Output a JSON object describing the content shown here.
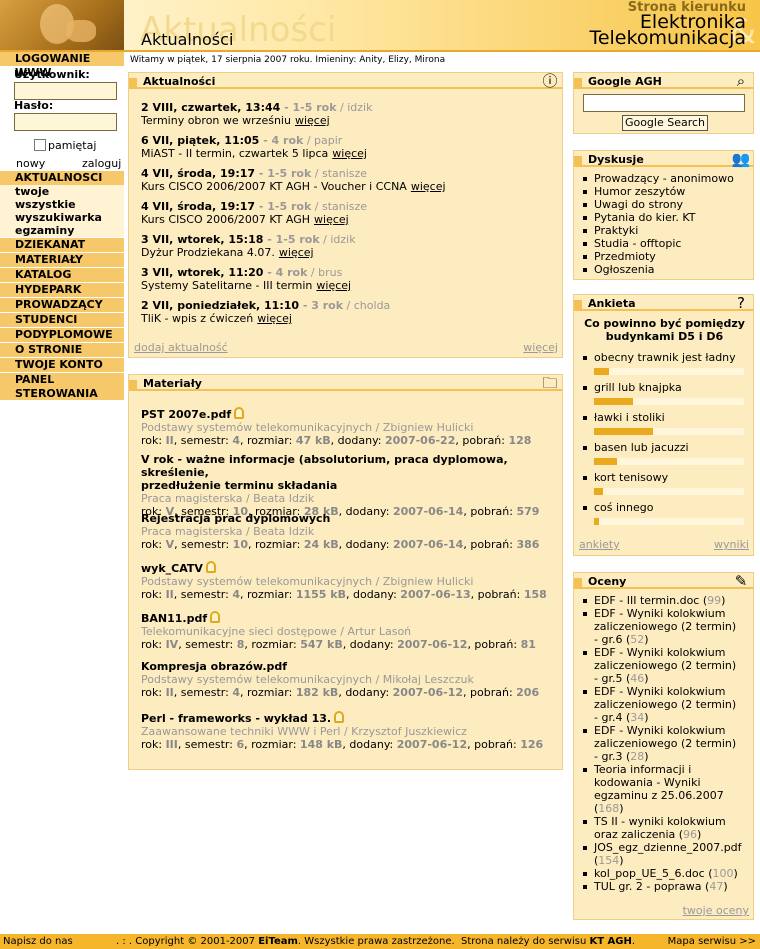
{
  "header": {
    "big_title": "Aktualności",
    "page_title": "Aktualności",
    "strona": "Strona kierunku",
    "kierunek_1": "Elektronika",
    "kierunek_2": "Telekomunikacja",
    "amp": "&"
  },
  "welcome": "Witamy w piątek, 17 sierpnia 2007 roku. Imieniny: Anity, Elizy, Mirona",
  "login": {
    "title": "LOGOWANIE WWW",
    "user_label": "Użytkownik:",
    "pass_label": "Hasło:",
    "remember": "pamiętaj",
    "new": "nowy",
    "login": "zaloguj"
  },
  "nav": {
    "aktualnosci": "AKTUALNOSCI",
    "sub": [
      "twoje",
      "wszystkie",
      "wyszukiwarka",
      "egzaminy"
    ],
    "items": [
      "DZIEKANAT",
      "MATERIAŁY",
      "KATALOG",
      "HYDEPARK",
      "PROWADZĄCY",
      "STUDENCI",
      "PODYPLOMOWE",
      "O STRONIE",
      "TWOJE KONTO"
    ],
    "panel_1": "PANEL",
    "panel_2": "STEROWANIA"
  },
  "news": {
    "title": "Aktualności",
    "items": [
      {
        "date": "2 VIII, czwartek, 13:44",
        "year": " - 1-5 rok",
        "author": " / idzik",
        "text": "Terminy obron we wrześniu",
        "more": "więcej"
      },
      {
        "date": "6 VII, piątek, 11:05",
        "year": " - 4 rok",
        "author": " / papir",
        "text": "MiAST - II termin, czwartek 5 lipca",
        "more": "więcej"
      },
      {
        "date": "4 VII, środa, 19:17",
        "year": " - 1-5 rok",
        "author": " / stanisze",
        "text": "Kurs CISCO 2006/2007 KT AGH - Voucher i CCNA",
        "more": "więcej"
      },
      {
        "date": "4 VII, środa, 19:17",
        "year": " - 1-5 rok",
        "author": " / stanisze",
        "text": "Kurs CISCO 2006/2007 KT AGH",
        "more": "więcej"
      },
      {
        "date": "3 VII, wtorek, 15:18",
        "year": " - 1-5 rok",
        "author": " / idzik",
        "text": "Dyżur Prodziekana 4.07.",
        "more": "więcej"
      },
      {
        "date": "3 VII, wtorek, 11:20",
        "year": " - 4 rok",
        "author": " / brus",
        "text": "Systemy Satelitarne - III termin",
        "more": "więcej"
      },
      {
        "date": "2 VII, poniedziałek, 11:10",
        "year": " - 3 rok",
        "author": " / cholda",
        "text": "TliK - wpis z ćwiczeń",
        "more": "więcej"
      }
    ],
    "add": "dodaj aktualność",
    "more": "więcej"
  },
  "materials": {
    "title": "Materiały",
    "items": [
      {
        "name": "PST 2007e.pdf",
        "lock": true,
        "course": "Podstawy systemów telekomunikacyjnych / Zbigniew Hulicki",
        "rok": "II",
        "sem": "4",
        "size": "47 kB",
        "date": "2007-06-22",
        "dl": "128"
      },
      {
        "name": "V rok - ważne informacje (absolutorium, praca dyplomowa, skreślenie,",
        "name2": "przedłużenie terminu składania",
        "lock": false,
        "course": "Praca magisterska / Beata Idzik",
        "rok": "V",
        "sem": "10",
        "size": "28 kB",
        "date": "2007-06-14",
        "dl": "579"
      },
      {
        "name": "Rejestracja prac dyplomowych",
        "lock": false,
        "course": "Praca magisterska / Beata Idzik",
        "rok": "V",
        "sem": "10",
        "size": "24 kB",
        "date": "2007-06-14",
        "dl": "386"
      },
      {
        "name": "wyk_CATV",
        "lock": true,
        "course": "Podstawy systemów telekomunikacyjnych / Zbigniew Hulicki",
        "rok": "II",
        "sem": "4",
        "size": "1155 kB",
        "date": "2007-06-13",
        "dl": "158"
      },
      {
        "name": "BAN11.pdf",
        "lock": true,
        "course": "Telekomunikacyjne sieci dostępowe / Artur Lasoń",
        "rok": "IV",
        "sem": "8",
        "size": "547 kB",
        "date": "2007-06-12",
        "dl": "81"
      },
      {
        "name": "Kompresja obrazów.pdf",
        "lock": false,
        "course": "Podstawy systemów telekomunikacyjnych / Mikołaj Leszczuk",
        "rok": "II",
        "sem": "4",
        "size": "182 kB",
        "date": "2007-06-12",
        "dl": "206"
      },
      {
        "name": "Perl - frameworks - wykład 13.",
        "lock": true,
        "course": "Zaawansowane techniki WWW i Perl / Krzysztof Juszkiewicz",
        "rok": "III",
        "sem": "6",
        "size": "148 kB",
        "date": "2007-06-12",
        "dl": "126"
      }
    ],
    "labels": {
      "rok": "rok: ",
      "sem": ", semestr: ",
      "size": ", rozmiar: ",
      "date": ", dodany: ",
      "dl": ", pobrań: "
    }
  },
  "google": {
    "title": "Google AGH",
    "button": "Google Search"
  },
  "forums": {
    "title": "Dyskusje",
    "items": [
      "Prowadzący - anonimowo",
      "Humor zeszytów",
      "Uwagi do strony",
      "Pytania do kier. KT",
      "Praktyki",
      "Studia - offtopic",
      "Przedmioty",
      "Ogłoszenia"
    ]
  },
  "poll": {
    "title": "Ankieta",
    "question": "Co powinno być pomiędzy budynkami D5 i D6",
    "options": [
      {
        "label": "obecny trawnik jest ładny",
        "frac": 0.1
      },
      {
        "label": "grill lub knajpka",
        "frac": 0.26
      },
      {
        "label": "ławki i stoliki",
        "frac": 0.39
      },
      {
        "label": "basen lub jacuzzi",
        "frac": 0.15
      },
      {
        "label": "kort tenisowy",
        "frac": 0.06
      },
      {
        "label": "coś innego",
        "frac": 0.03
      }
    ],
    "surveys": "ankiety",
    "results": "wyniki"
  },
  "grades": {
    "title": "Oceny",
    "items": [
      {
        "l": [
          "EDF - III termin.doc"
        ],
        "n": "99"
      },
      {
        "l": [
          "EDF - Wyniki kolokwium",
          "zaliczeniowego (2 termin)",
          "- gr.6"
        ],
        "n": "52"
      },
      {
        "l": [
          "EDF - Wyniki kolokwium",
          "zaliczeniowego (2 termin)",
          "- gr.5"
        ],
        "n": "46"
      },
      {
        "l": [
          "EDF - Wyniki kolokwium",
          "zaliczeniowego (2 termin)",
          "- gr.4"
        ],
        "n": "34"
      },
      {
        "l": [
          "EDF - Wyniki kolokwium",
          "zaliczeniowego (2 termin)",
          "- gr.3"
        ],
        "n": "28"
      },
      {
        "l": [
          "Teoria informacji i",
          "kodowania - Wyniki",
          "egzaminu z 25.06.2007",
          ""
        ],
        "n": "168"
      },
      {
        "l": [
          "TS II - wyniki kolokwium",
          "oraz zaliczenia"
        ],
        "n": "96"
      },
      {
        "l": [
          "JOS_egz_dzienne_2007.pdf",
          ""
        ],
        "n": "154"
      },
      {
        "l": [
          "kol_pop_UE_5_6.doc"
        ],
        "n": "100"
      },
      {
        "l": [
          "TUL gr. 2 - poprawa"
        ],
        "n": "47"
      }
    ],
    "yours": "twoje oceny"
  },
  "footer": {
    "write": "Napisz do nas",
    "dots": ". : .",
    "copy_a": " Copyright © 2001-2007 ",
    "eiteam": "EiTeam",
    "copy_b": ". Wszystkie prawa zastrzeżone.",
    "serwis_a": "Strona należy do serwisu ",
    "kt": "KT AGH",
    "serwis_b": ".",
    "map": "Mapa serwisu >>"
  }
}
